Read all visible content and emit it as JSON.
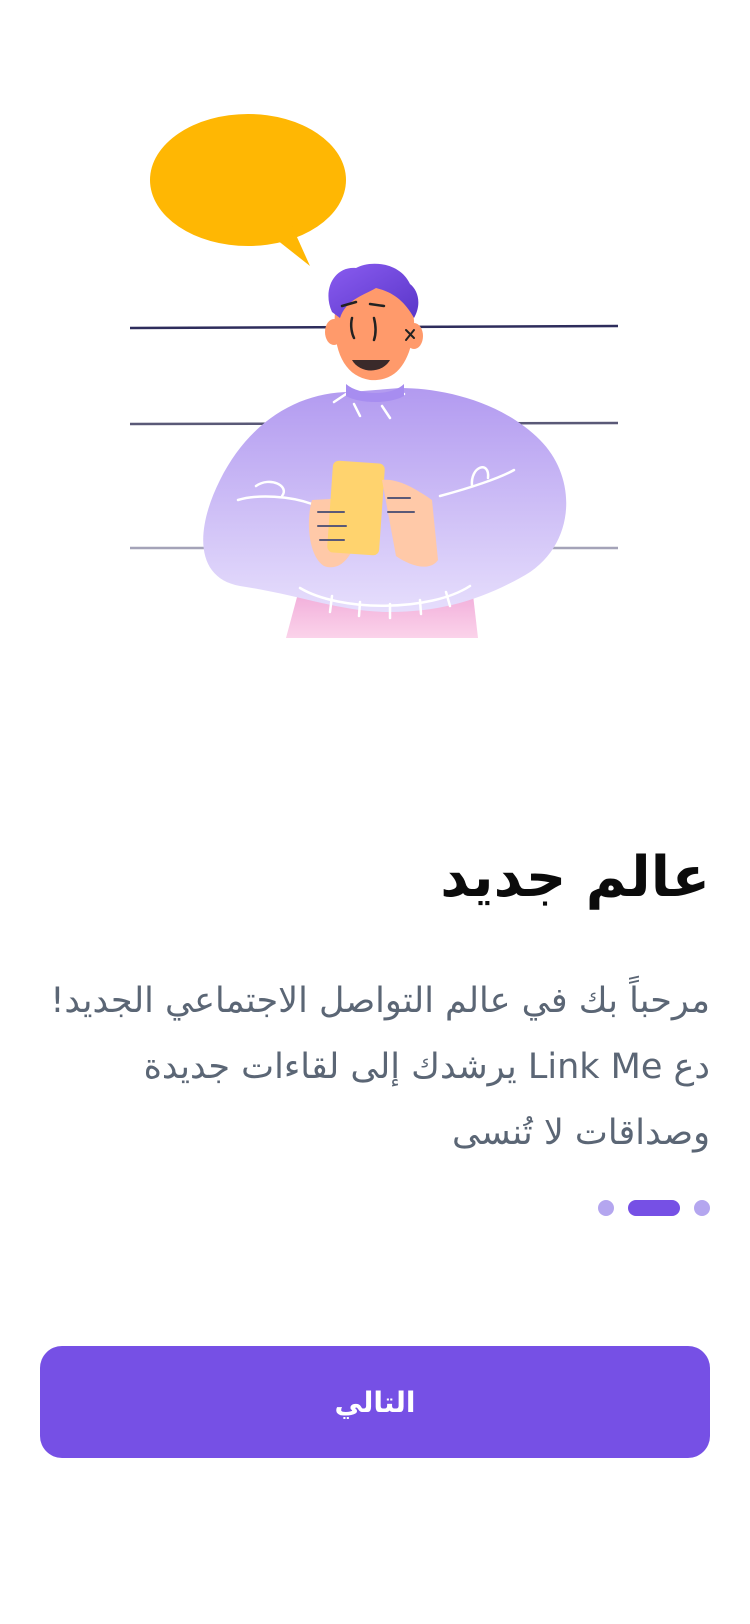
{
  "onboarding": {
    "title": "عالم جديد",
    "description": "مرحباً بك في عالم التواصل الاجتماعي الجديد! دع Link Me يرشدك إلى لقاءات جديدة وصداقات لا تُنسى",
    "pager": {
      "total_pages": 3,
      "current_page": 2
    },
    "next_button_label": "التالي"
  },
  "colors": {
    "accent": "#7650e5",
    "dot_inactive": "#b4a6ef",
    "speech_bubble": "#ffb703",
    "title_text": "#0b0b0b",
    "body_text": "#5b6675"
  }
}
